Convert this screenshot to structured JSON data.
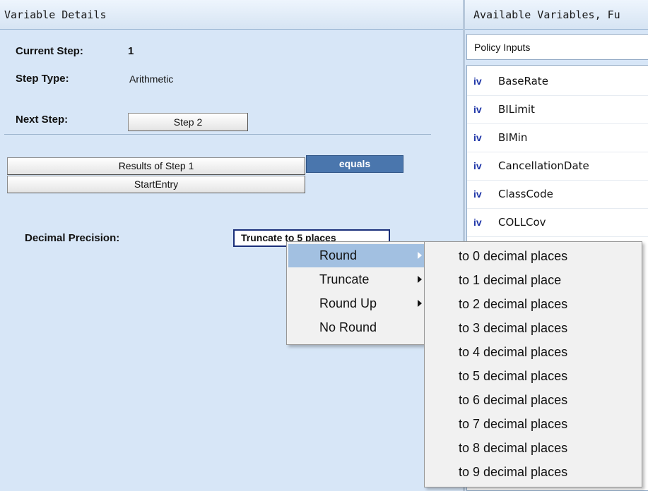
{
  "left_panel": {
    "title": "Variable Details",
    "current_step_label": "Current Step:",
    "current_step_value": "1",
    "step_type_label": "Step Type:",
    "step_type_value": "Arithmetic",
    "next_step_label": "Next Step:",
    "next_step_button": "Step 2",
    "result_button": "Results of Step 1",
    "operator_button": "equals",
    "start_entry_button": "StartEntry",
    "decimal_precision_label": "Decimal Precision:",
    "decimal_precision_value": "Truncate to 5 places"
  },
  "right_panel": {
    "title": "Available Variables, Fu",
    "category_select": "Policy Inputs",
    "variable_icon_text": "iv",
    "variables": [
      {
        "name": "BaseRate"
      },
      {
        "name": "BILimit"
      },
      {
        "name": "BIMin"
      },
      {
        "name": "CancellationDate"
      },
      {
        "name": "ClassCode"
      },
      {
        "name": "COLLCov"
      }
    ]
  },
  "context_menu": {
    "items": [
      {
        "label": "Round",
        "has_submenu": true,
        "highlighted": true
      },
      {
        "label": "Truncate",
        "has_submenu": true,
        "highlighted": false
      },
      {
        "label": "Round Up",
        "has_submenu": true,
        "highlighted": false
      },
      {
        "label": "No Round",
        "has_submenu": false,
        "highlighted": false
      }
    ],
    "submenu_items": [
      "to 0 decimal places",
      "to 1 decimal place",
      "to 2 decimal places",
      "to 3 decimal places",
      "to 4 decimal places",
      "to 5 decimal places",
      "to 6 decimal places",
      "to 7 decimal places",
      "to 8 decimal places",
      "to 9 decimal places"
    ]
  },
  "colors": {
    "panel_background": "#d7e6f7",
    "accent_button": "#4a76ad",
    "menu_highlight": "#a2c0e1",
    "variable_icon": "#1f36a8"
  }
}
